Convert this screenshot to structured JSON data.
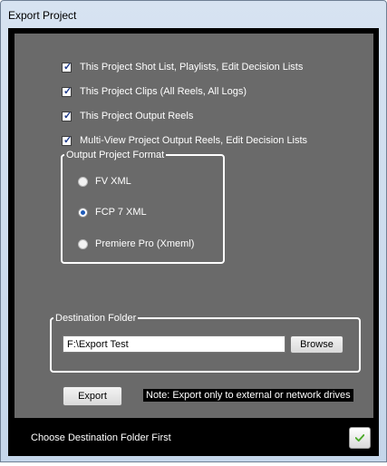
{
  "window": {
    "title": "Export Project"
  },
  "options": [
    {
      "label": "This Project Shot List, Playlists, Edit Decision Lists",
      "checked": true
    },
    {
      "label": "This Project Clips (All Reels, All Logs)",
      "checked": true
    },
    {
      "label": "This Project Output Reels",
      "checked": true
    },
    {
      "label": "Multi-View Project Output Reels, Edit Decision Lists",
      "checked": true
    }
  ],
  "format": {
    "legend": "Output Project Format",
    "choices": [
      {
        "label": "FV XML",
        "selected": false
      },
      {
        "label": "FCP 7 XML",
        "selected": true
      },
      {
        "label": "Premiere Pro (Xmeml)",
        "selected": false
      }
    ]
  },
  "destination": {
    "legend": "Destination Folder",
    "path": "F:\\Export Test",
    "browse_label": "Browse"
  },
  "export_label": "Export",
  "note": "Note: Export only to external or network drives",
  "status": "Choose Destination Folder First",
  "colors": {
    "panel": "#6a6a6a",
    "accent": "#4caa2a"
  }
}
